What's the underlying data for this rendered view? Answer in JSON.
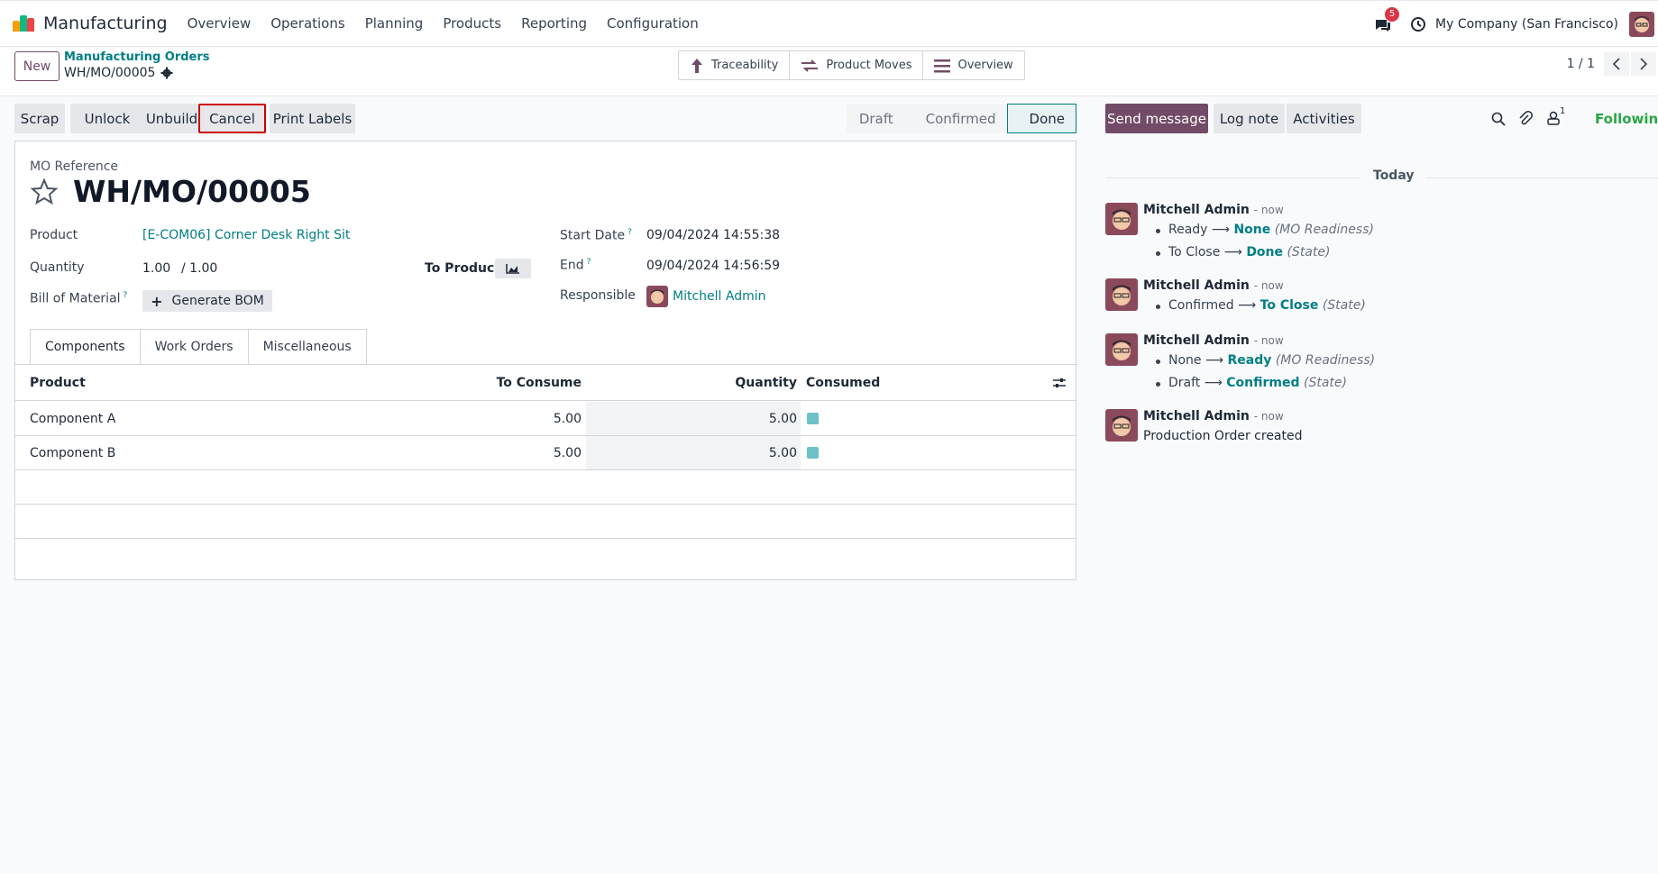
{
  "app": {
    "name": "Manufacturing"
  },
  "menu": [
    "Overview",
    "Operations",
    "Planning",
    "Products",
    "Reporting",
    "Configuration"
  ],
  "nav": {
    "messages_badge": "5",
    "company": "My Company (San Francisco)"
  },
  "control": {
    "new_label": "New",
    "breadcrumb_parent": "Manufacturing Orders",
    "breadcrumb_current": "WH/MO/00005",
    "smart_buttons": [
      "Traceability",
      "Product Moves",
      "Overview"
    ],
    "pager": "1 / 1"
  },
  "actions": [
    "Scrap",
    "Unlock",
    "Unbuild",
    "Cancel",
    "Print Labels"
  ],
  "stages": [
    "Draft",
    "Confirmed",
    "Done"
  ],
  "form": {
    "mo_reference_label": "MO Reference",
    "title": "WH/MO/00005",
    "product_label": "Product",
    "product_value": "[E-COM06] Corner Desk Right Sit",
    "quantity_label": "Quantity",
    "quantity_value": "1.00",
    "quantity_total": "/ 1.00",
    "to_produce_label": "To Produce",
    "bom_label": "Bill of Material",
    "generate_bom": "Generate BOM",
    "start_date_label": "Start Date",
    "start_date_value": "09/04/2024 14:55:38",
    "end_label": "End",
    "end_value": "09/04/2024 14:56:59",
    "responsible_label": "Responsible",
    "responsible_value": "Mitchell Admin"
  },
  "tabs": [
    "Components",
    "Work Orders",
    "Miscellaneous"
  ],
  "table": {
    "headers": [
      "Product",
      "To Consume",
      "Quantity",
      "Consumed"
    ],
    "rows": [
      {
        "product": "Component A",
        "to_consume": "5.00",
        "quantity": "5.00"
      },
      {
        "product": "Component B",
        "to_consume": "5.00",
        "quantity": "5.00"
      }
    ]
  },
  "chatter": {
    "send_message": "Send message",
    "log_note": "Log note",
    "activities": "Activities",
    "followers_count": "1",
    "following": "Following",
    "today": "Today",
    "messages": [
      {
        "author": "Mitchell Admin",
        "time": "- now",
        "changes": [
          {
            "old": "Ready",
            "new": "None",
            "field": "(MO Readiness)"
          },
          {
            "old": "To Close",
            "new": "Done",
            "field": "(State)"
          }
        ]
      },
      {
        "author": "Mitchell Admin",
        "time": "- now",
        "changes": [
          {
            "old": "Confirmed",
            "new": "To Close",
            "field": "(State)"
          }
        ]
      },
      {
        "author": "Mitchell Admin",
        "time": "- now",
        "changes": [
          {
            "old": "None",
            "new": "Ready",
            "field": "(MO Readiness)"
          },
          {
            "old": "Draft",
            "new": "Confirmed",
            "field": "(State)"
          }
        ]
      },
      {
        "author": "Mitchell Admin",
        "time": "- now",
        "body": "Production Order created"
      }
    ]
  },
  "colors": {
    "brand": "#714b67",
    "link": "#017e84",
    "following": "#28a745",
    "badge": "#dc3545"
  }
}
